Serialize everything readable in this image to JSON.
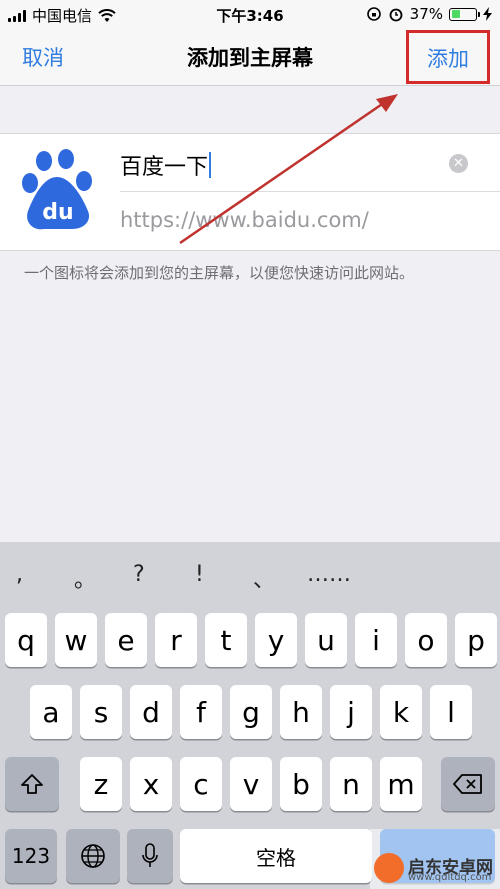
{
  "status": {
    "carrier": "中国电信",
    "time": "下午3:46",
    "battery": "37%",
    "battery_level": 0.37
  },
  "nav": {
    "cancel": "取消",
    "title": "添加到主屏幕",
    "add": "添加"
  },
  "card": {
    "name": "百度一下",
    "url": "https://www.baidu.com/",
    "icon_text": "du"
  },
  "hint": "一个图标将会添加到您的主屏幕，以便您快速访问此网站。",
  "keyboard": {
    "punct": [
      ",",
      "。",
      "?",
      "!",
      "、",
      "……"
    ],
    "row1": [
      "q",
      "w",
      "e",
      "r",
      "t",
      "y",
      "u",
      "i",
      "o",
      "p"
    ],
    "row2": [
      "a",
      "s",
      "d",
      "f",
      "g",
      "h",
      "j",
      "k",
      "l"
    ],
    "row3": [
      "z",
      "x",
      "c",
      "v",
      "b",
      "n",
      "m"
    ],
    "num_label": "123",
    "space_label": "空格"
  },
  "watermark": {
    "brand": "启东安卓网",
    "url": "www.qdltdq.com"
  },
  "colors": {
    "accent": "#2f7de1",
    "highlight": "#d42a2a",
    "battery": "#4cd964"
  }
}
